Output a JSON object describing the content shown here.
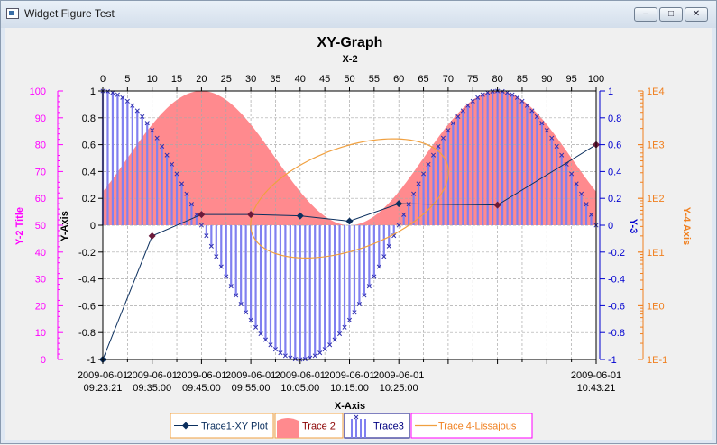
{
  "window": {
    "title": "Widget Figure Test"
  },
  "chart_data": {
    "type": "line",
    "title": "XY-Graph",
    "xlabel": "X-Axis",
    "x2label": "X-2",
    "ylabel": "Y-Axis",
    "y2label": "Y-2 Title",
    "y3label": "Y-3",
    "y4label": "Y-4 Axis",
    "xlim": [
      0,
      100
    ],
    "ylim": [
      -1,
      1
    ],
    "y2lim": [
      0,
      100
    ],
    "y4lim_log": [
      -1,
      4
    ],
    "x2_ticks": [
      "0",
      "5",
      "10",
      "15",
      "20",
      "25",
      "30",
      "35",
      "40",
      "45",
      "50",
      "55",
      "60",
      "65",
      "70",
      "75",
      "80",
      "85",
      "90",
      "95",
      "100"
    ],
    "y_ticks": [
      "1",
      "0.8",
      "0.6",
      "0.4",
      "0.2",
      "0",
      "-0.2",
      "-0.4",
      "-0.6",
      "-0.8",
      "-1"
    ],
    "y2_ticks": [
      "100",
      "90",
      "80",
      "70",
      "60",
      "50",
      "40",
      "30",
      "20",
      "10",
      "0"
    ],
    "y4_ticks": [
      "1E4",
      "1E3",
      "1E2",
      "1E1",
      "1E0",
      "1E-1"
    ],
    "x_ticks": [
      {
        "x": 0,
        "date": "2009-06-01",
        "time": "09:23:21"
      },
      {
        "x": 10,
        "date": "2009-06-01",
        "time": "09:35:00"
      },
      {
        "x": 20,
        "date": "2009-06-01",
        "time": "09:45:00"
      },
      {
        "x": 30,
        "date": "2009-06-01",
        "time": "09:55:00"
      },
      {
        "x": 40,
        "date": "2009-06-01",
        "time": "10:05:00"
      },
      {
        "x": 50,
        "date": "2009-06-01",
        "time": "10:15:00"
      },
      {
        "x": 60,
        "date": "2009-06-01",
        "time": "10:25:00"
      },
      {
        "x": 100,
        "date": "2009-06-01",
        "time": "10:43:21"
      }
    ],
    "grid": true,
    "legend_position": "bottom",
    "series": [
      {
        "name": "Trace1-XY Plot",
        "kind": "line-markers",
        "color": "#0b2f5e",
        "points": [
          [
            0,
            -1
          ],
          [
            10,
            -0.08
          ],
          [
            20,
            0.08
          ],
          [
            30,
            0.08
          ],
          [
            40,
            0.07
          ],
          [
            50,
            0.03
          ],
          [
            60,
            0.16
          ],
          [
            80,
            0.15
          ],
          [
            100,
            0.6
          ]
        ]
      },
      {
        "name": "Trace 2",
        "kind": "filled-area",
        "color": "#ff8a8e",
        "formula": "y = 0.5 + 0.5*cos(2*pi*(x-20)/60)"
      },
      {
        "name": "Trace3",
        "kind": "sticks-markers",
        "color": "#8080f0",
        "formula": "y = cos(2*pi*x/80)"
      },
      {
        "name": "Trace 4-Lissajous",
        "kind": "ellipse",
        "color": "#f0a040",
        "center": [
          50,
          0.2
        ],
        "semi_axis_x": 21,
        "semi_axis_y": 0.38,
        "rotation_deg": -20
      }
    ]
  }
}
